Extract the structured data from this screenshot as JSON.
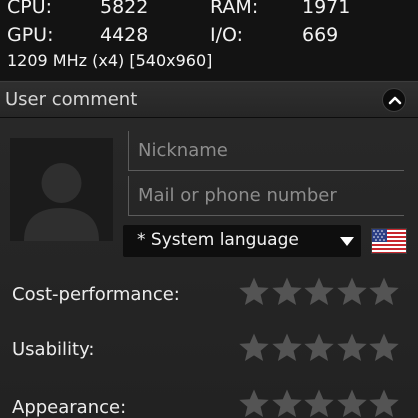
{
  "stats": {
    "cpu_label": "CPU:",
    "cpu_value": "5822",
    "ram_label": "RAM:",
    "ram_value": "1971",
    "gpu_label": "GPU:",
    "gpu_value": "4428",
    "io_label": "I/O:",
    "io_value": "669",
    "frequency": "1209 MHz (x4) [540x960]"
  },
  "comment": {
    "title": "User comment",
    "nickname_placeholder": "Nickname",
    "contact_placeholder": "Mail or phone number",
    "language_value": "* System language",
    "flag_icon": "us-flag-icon"
  },
  "ratings": [
    {
      "label": "Cost-performance:",
      "stars": 0,
      "max": 5
    },
    {
      "label": "Usability:",
      "stars": 0,
      "max": 5
    },
    {
      "label": "Appearance:",
      "stars": 0,
      "max": 5
    }
  ],
  "colors": {
    "background": "#161616",
    "panel": "#262626",
    "star_empty": "#545454"
  }
}
